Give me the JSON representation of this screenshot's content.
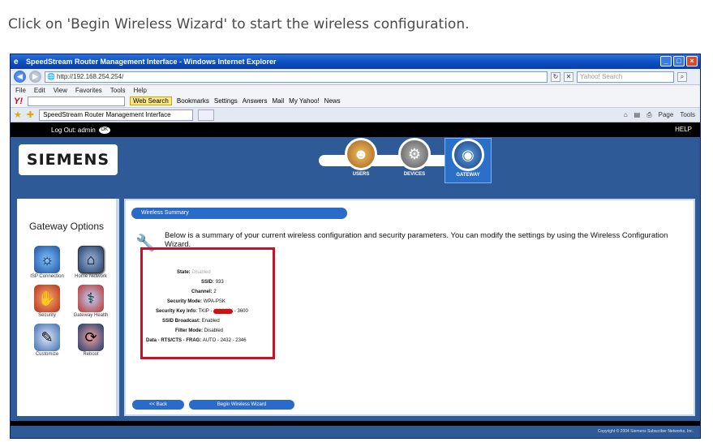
{
  "instruction": "Click on 'Begin Wireless Wizard' to start the wireless configuration.",
  "browser": {
    "title": "SpeedStream Router Management Interface - Windows Internet Explorer",
    "url": "http://192.168.254.254/",
    "search_placeholder": "Yahoo! Search",
    "menu": [
      "File",
      "Edit",
      "View",
      "Favorites",
      "Tools",
      "Help"
    ],
    "yahoo_toolbar": {
      "logo": "Y!",
      "search_button": "Web Search",
      "items": [
        "Bookmarks",
        "Settings",
        "Answers",
        "Mail",
        "My Yahoo!",
        "News"
      ]
    },
    "tab_title": "SpeedStream Router Management Interface",
    "right_tools": [
      "Page",
      "Tools"
    ]
  },
  "router": {
    "logout_label": "Log Out: admin",
    "logout_badge": "OK",
    "help_label": "HELP",
    "brand": "SIEMENS",
    "nav_tabs": [
      {
        "label": "USERS"
      },
      {
        "label": "DEVICES"
      },
      {
        "label": "GATEWAY"
      }
    ],
    "left_heading": "Gateway Options",
    "options": [
      {
        "label": "ISP Connection"
      },
      {
        "label": "Home Network"
      },
      {
        "label": "Security"
      },
      {
        "label": "Gateway Health"
      },
      {
        "label": "Customize"
      },
      {
        "label": "Reboot"
      }
    ],
    "section_title": "Wireless Summary",
    "intro": "Below is a summary of your current wireless configuration and security parameters. You can modify the settings by using the Wireless Configuration Wizard.",
    "summary": {
      "state_label": "State:",
      "state_value": "Disabled",
      "ssid_label": "SSID:",
      "ssid_value": "933",
      "channel_label": "Channel:",
      "channel_value": "2",
      "security_mode_label": "Security Mode:",
      "security_mode_value": "WPA-PSK",
      "security_key_label": "Security Key Info:",
      "security_key_prefix": "TKIP -",
      "security_key_suffix": "- 3600",
      "ssid_broadcast_label": "SSID Broadcast:",
      "ssid_broadcast_value": "Enabled",
      "filter_mode_label": "Filter Mode:",
      "filter_mode_value": "Disabled",
      "rts_label": "Data - RTS/CTS - FRAG:",
      "rts_value": "AUTO - 2432 - 2346"
    },
    "back_button": "<< Back",
    "wizard_button": "Begin Wireless Wizard",
    "copyright": "Copyright © 2004 Siemens Subscriber Networks, Inc."
  }
}
